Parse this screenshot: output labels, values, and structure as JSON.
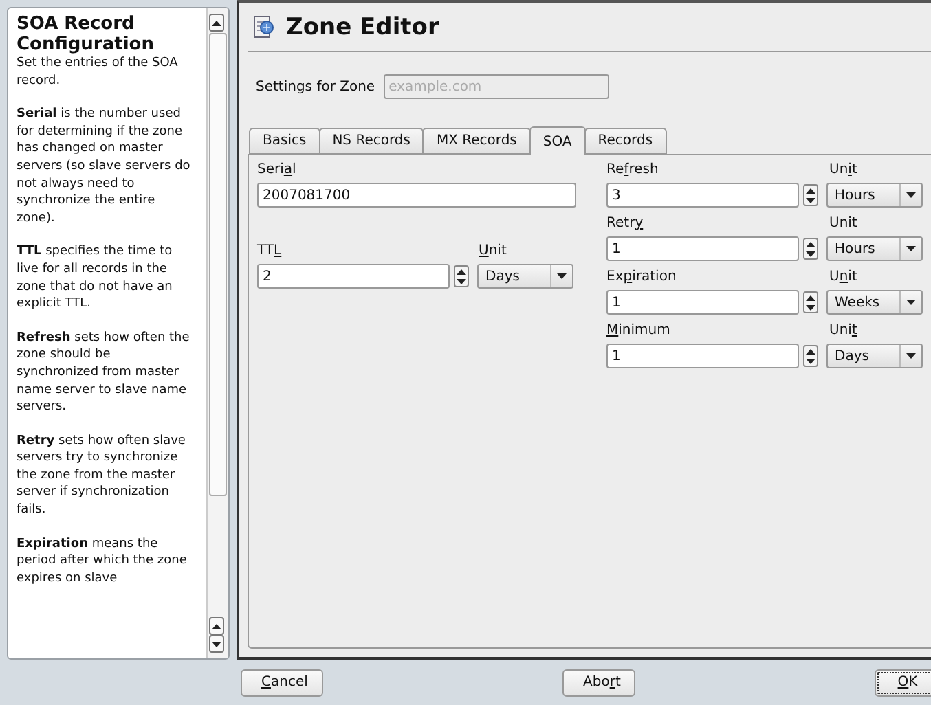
{
  "help": {
    "title": "SOA Record Configuration",
    "paragraphs": [
      "Set the entries of the SOA record.",
      "**Serial** is the number used for determining if the zone has changed on master servers (so slave servers do not always need to synchronize the entire zone).",
      "**TTL** specifies the time to live for all records in the zone that do not have an explicit TTL.",
      "**Refresh** sets how often the zone should be synchronized from master name server to slave name servers.",
      "**Retry** sets how often slave servers try to synchronize the zone from the master server if synchronization fails.",
      "**Expiration** means the period after which the zone expires on slave"
    ]
  },
  "header": {
    "title": "Zone Editor"
  },
  "zone": {
    "label": "Settings for Zone",
    "value": "example.com",
    "disabled": true
  },
  "tabs": [
    {
      "label": "Basics",
      "selected": false
    },
    {
      "label": "NS Records",
      "selected": false
    },
    {
      "label": "MX Records",
      "selected": false
    },
    {
      "label": "SOA",
      "selected": true
    },
    {
      "label": "Records",
      "selected": false
    }
  ],
  "left_fields": [
    {
      "kind": "text",
      "label": {
        "before": "Seri",
        "access_key": "a",
        "after": "l"
      },
      "value": "2007081700"
    },
    {
      "kind": "spin",
      "label": {
        "before": "TT",
        "access_key": "L"
      },
      "value": "2",
      "unit_label": {
        "access_key": "U",
        "after": "nit"
      },
      "unit": "Days"
    }
  ],
  "right_fields": [
    {
      "kind": "spin",
      "label": {
        "before": "Re",
        "access_key": "f",
        "after": "resh"
      },
      "value": "3",
      "unit_label": {
        "before": "Un",
        "access_key": "i",
        "after": "t"
      },
      "unit": "Hours"
    },
    {
      "kind": "spin",
      "label": {
        "before": "Retr",
        "access_key": "y"
      },
      "value": "1",
      "unit_label": {
        "before": "Unit"
      },
      "unit": "Hours"
    },
    {
      "kind": "spin",
      "label": {
        "before": "Ex",
        "access_key": "p",
        "after": "iration"
      },
      "value": "1",
      "unit_label": {
        "before": "U",
        "access_key": "n",
        "after": "it"
      },
      "unit": "Weeks"
    },
    {
      "kind": "spin",
      "label": {
        "access_key": "M",
        "after": "inimum"
      },
      "value": "1",
      "unit_label": {
        "before": "Uni",
        "access_key": "t"
      },
      "unit": "Days"
    }
  ],
  "buttons": [
    {
      "label": {
        "access_key": "C",
        "after": "ancel"
      },
      "focused": false
    },
    {
      "label": {
        "before": "Abo",
        "access_key": "r",
        "after": "t"
      },
      "focused": false
    },
    {
      "label": {
        "access_key": "O",
        "after": "K"
      },
      "focused": true
    }
  ]
}
